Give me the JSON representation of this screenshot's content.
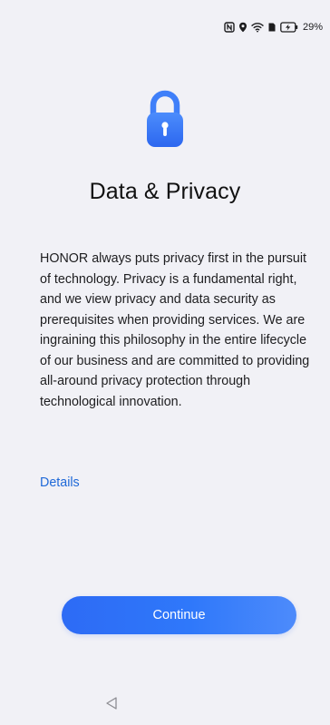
{
  "status_bar": {
    "icons": [
      "nfc-icon",
      "location-icon",
      "wifi-icon",
      "sim-icon",
      "battery-charging-icon"
    ],
    "battery": "29%"
  },
  "header": {
    "icon": "lock-icon",
    "title": "Data & Privacy"
  },
  "content": {
    "body": "HONOR always puts privacy first in the pursuit of technology. Privacy is a fundamental right, and we view privacy and data security as prerequisites when providing services. We are ingraining this philosophy in the entire lifecycle of our business and are committed to providing all-around privacy protection through technological innovation.",
    "details_link": "Details"
  },
  "actions": {
    "continue_label": "Continue"
  },
  "nav": {
    "back_icon": "back-triangle-icon"
  },
  "colors": {
    "background": "#f1f1f6",
    "accent": "#2f78fa",
    "link": "#1f69d8",
    "text": "#1d1d1f"
  }
}
